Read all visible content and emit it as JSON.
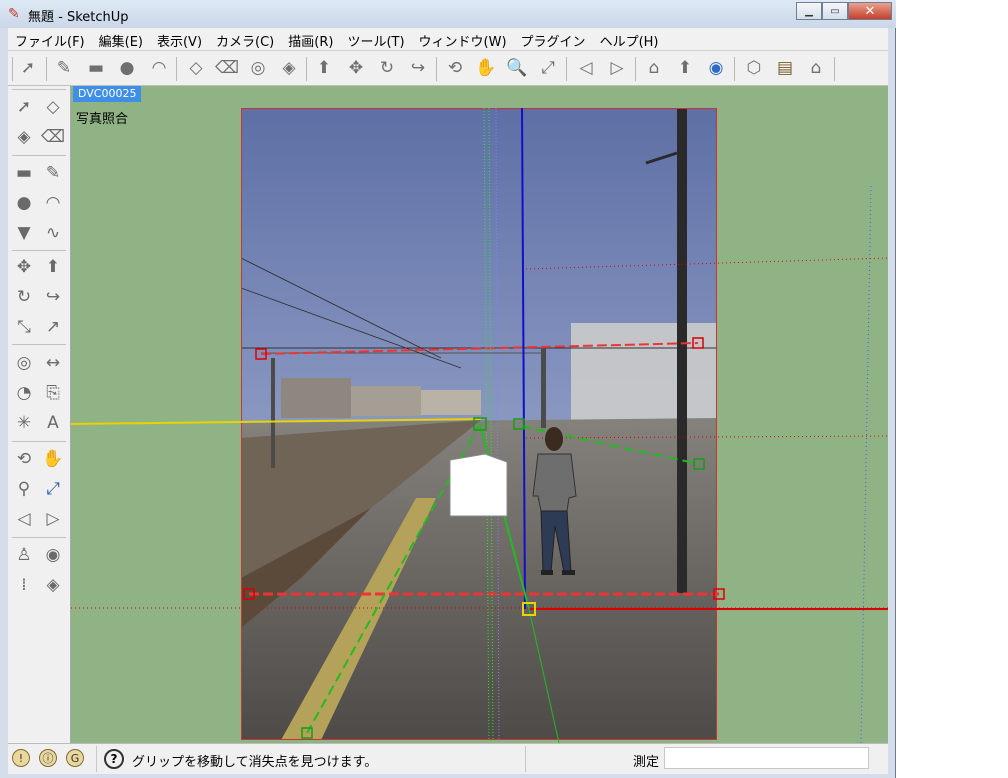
{
  "window": {
    "title": "無題 - SketchUp"
  },
  "menu": [
    "ファイル(F)",
    "編集(E)",
    "表示(V)",
    "カメラ(C)",
    "描画(R)",
    "ツール(T)",
    "ウィンドウ(W)",
    "プラグイン",
    "ヘルプ(H)"
  ],
  "toolbar_icons": [
    "select-icon",
    "pencil-icon",
    "rectangle-icon",
    "circle-icon",
    "arc-icon",
    "make-component-icon",
    "eraser-icon",
    "tape-measure-icon",
    "paint-bucket-icon",
    "push-pull-icon",
    "move-icon",
    "rotate-icon",
    "follow-me-icon",
    "orbit-icon",
    "pan-icon",
    "zoom-icon",
    "zoom-extents-icon",
    "previous-view-icon",
    "next-view-icon",
    "3d-warehouse-icon",
    "get-models-icon",
    "share-model-icon",
    "google-earth-icon",
    "component-icon",
    "layer-icon",
    "house-icon"
  ],
  "scene": {
    "tab": "DVC00025",
    "name": "写真照合"
  },
  "status": {
    "message": "グリップを移動して消失点を見つけます。",
    "measure_label": "測定",
    "measure_value": ""
  },
  "colors": {
    "viewport_bg": "#8fb385",
    "scene_tab": "#3f8ee8",
    "axis_red": "#d00000",
    "axis_green": "#22bb22",
    "axis_blue": "#1010cc",
    "horizon_yellow": "#e8d200"
  }
}
